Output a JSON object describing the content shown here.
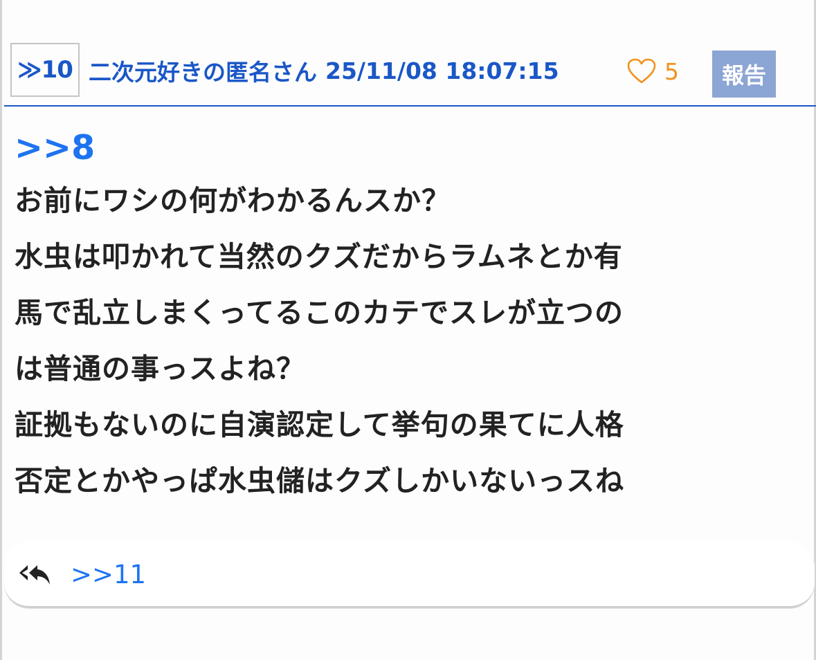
{
  "post": {
    "number": "≫10",
    "author": "二次元好きの匿名さん",
    "datetime": "25/11/08 18:07:15",
    "likes": "5",
    "report_label": "報告",
    "reply_to": ">>8",
    "lines": [
      "お前にワシの何がわかるんスか？",
      "水虫は叩かれて当然のクズだからラムネとか有",
      "馬で乱立しまくってるこのカテでスレが立つの",
      "は普通の事っスよね？",
      "証拠もないのに自演認定して挙句の果てに人格",
      "否定とかやっぱ水虫儲はクズしかいないっスね"
    ]
  },
  "replies": {
    "icon": "reply-all-icon",
    "link": ">>11"
  },
  "colors": {
    "accent": "#1a57c7",
    "link": "#1e74f0",
    "like": "#f0921e",
    "report_bg": "#8ba5d4",
    "text": "#222222"
  }
}
